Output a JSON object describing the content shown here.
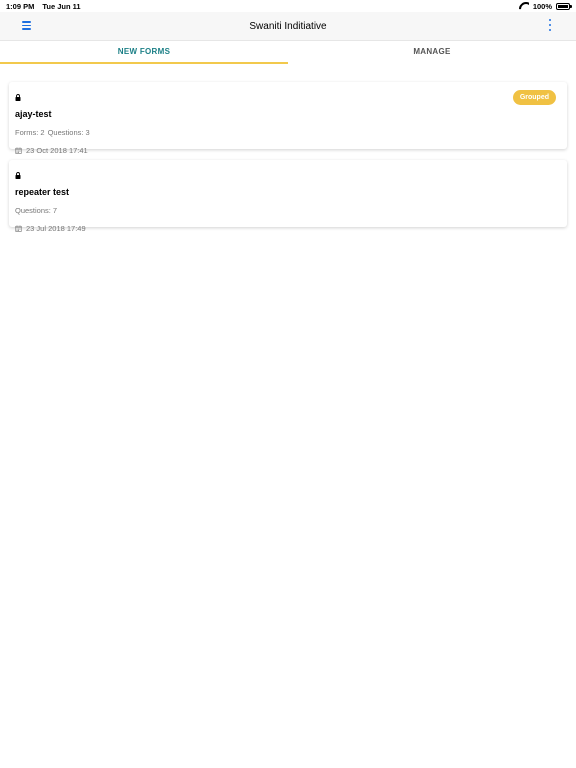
{
  "status_bar": {
    "time": "1:09 PM",
    "date": "Tue Jun 11",
    "battery": "100%"
  },
  "navbar": {
    "title": "Swaniti Inditiative",
    "menu_icon": "hamburger-menu-icon",
    "more_icon": "vertical-ellipsis-icon",
    "accent_color": "#1e6fe0"
  },
  "tabs": [
    {
      "label": "NEW FORMS",
      "active": true
    },
    {
      "label": "MANAGE",
      "active": false
    }
  ],
  "cards": [
    {
      "title": "ajay-test",
      "badge": "Grouped",
      "forms_label": "Forms: 2",
      "questions_label": "Questions: 3",
      "date": "23 Oct 2018 17:41"
    },
    {
      "title": "repeater test",
      "questions_label": "Questions: 7",
      "date": "23 Jul 2018 17:49"
    }
  ],
  "colors": {
    "tab_active": "#1b7f86",
    "tab_underline": "#f2c94c",
    "badge": "#f0c143"
  }
}
